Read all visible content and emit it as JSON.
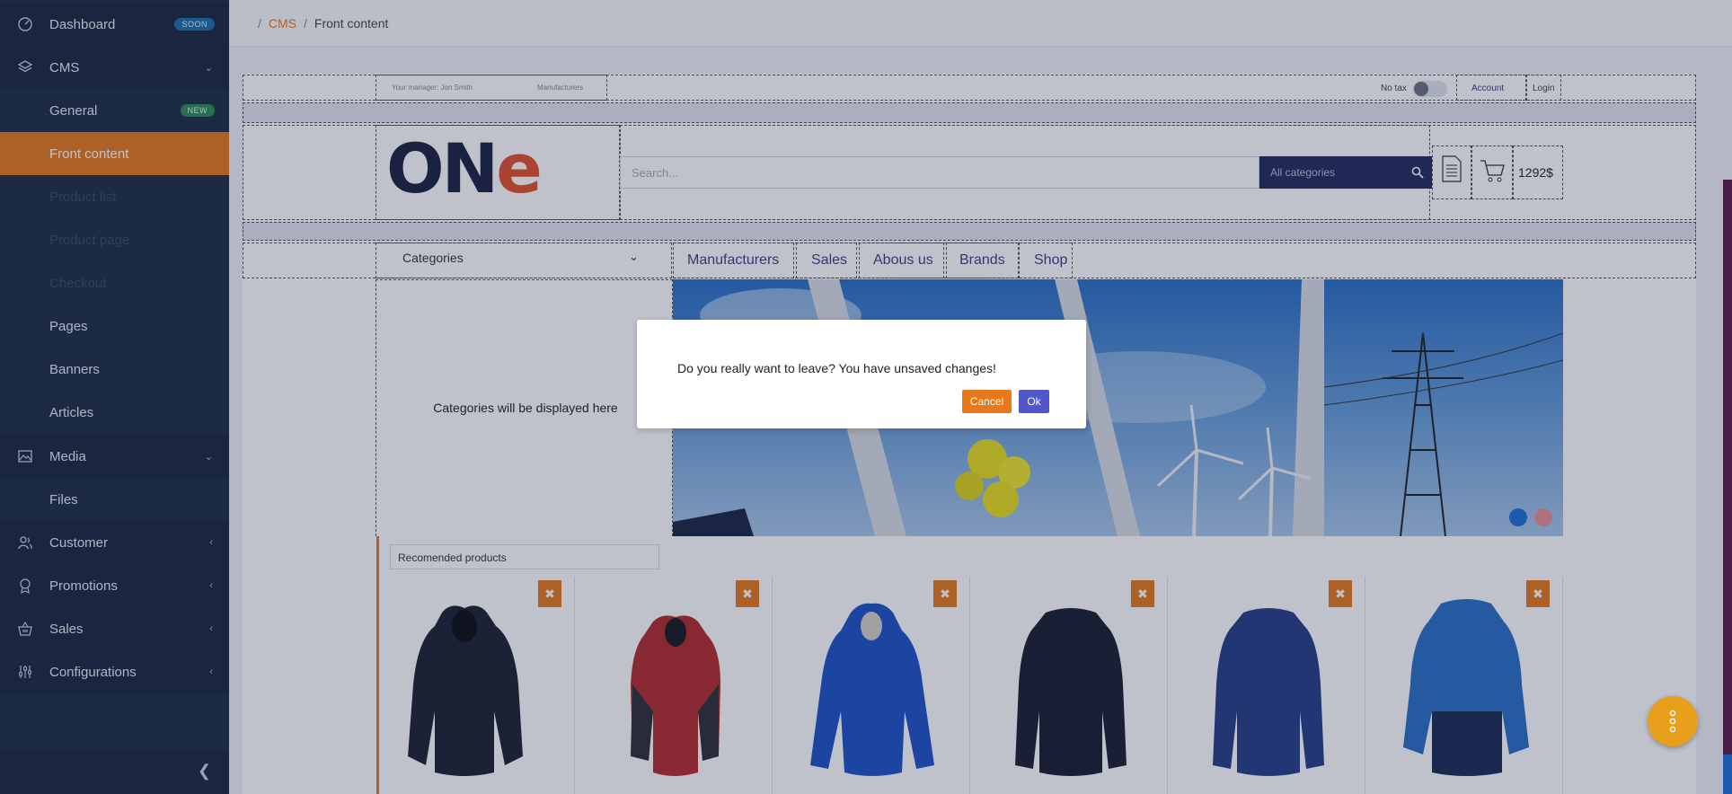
{
  "sidebar": {
    "items": [
      {
        "label": "Dashboard",
        "badge": "SOON",
        "icon": "dashboard-icon"
      },
      {
        "label": "CMS",
        "icon": "layers-icon"
      },
      {
        "label": "General",
        "badge": "NEW"
      },
      {
        "label": "Front content"
      },
      {
        "label": "Product list"
      },
      {
        "label": "Product page"
      },
      {
        "label": "Checkout"
      },
      {
        "label": "Pages"
      },
      {
        "label": "Banners"
      },
      {
        "label": "Articles"
      },
      {
        "label": "Media",
        "icon": "image-icon"
      },
      {
        "label": "Files"
      },
      {
        "label": "Customer",
        "icon": "users-icon"
      },
      {
        "label": "Promotions",
        "icon": "award-icon"
      },
      {
        "label": "Sales",
        "icon": "basket-icon"
      },
      {
        "label": "Configurations",
        "icon": "sliders-icon"
      }
    ]
  },
  "breadcrumb": {
    "parent": "CMS",
    "current": "Front content"
  },
  "preview": {
    "topbar": {
      "manager": "Your manager: Jon Smith",
      "manufacturers": "Manufacturers",
      "no_tax": "No tax",
      "account": "Account",
      "login": "Login"
    },
    "search_placeholder": "Search...",
    "all_categories": "All categories",
    "cart_total": "1292$",
    "categories_label": "Categories",
    "nav": [
      "Manufacturers",
      "Sales",
      "Abous us",
      "Brands",
      "Shop"
    ],
    "categories_placeholder": "Categories will be displayed here",
    "recommended_label": "Recomended products"
  },
  "modal": {
    "message": "Do you really want to leave? You have unsaved changes!",
    "cancel": "Cancel",
    "ok": "Ok"
  },
  "colors": {
    "accent": "#e7791b",
    "sidebar": "#1f2d44",
    "primary": "#5256c8",
    "navy": "#252a5c"
  }
}
